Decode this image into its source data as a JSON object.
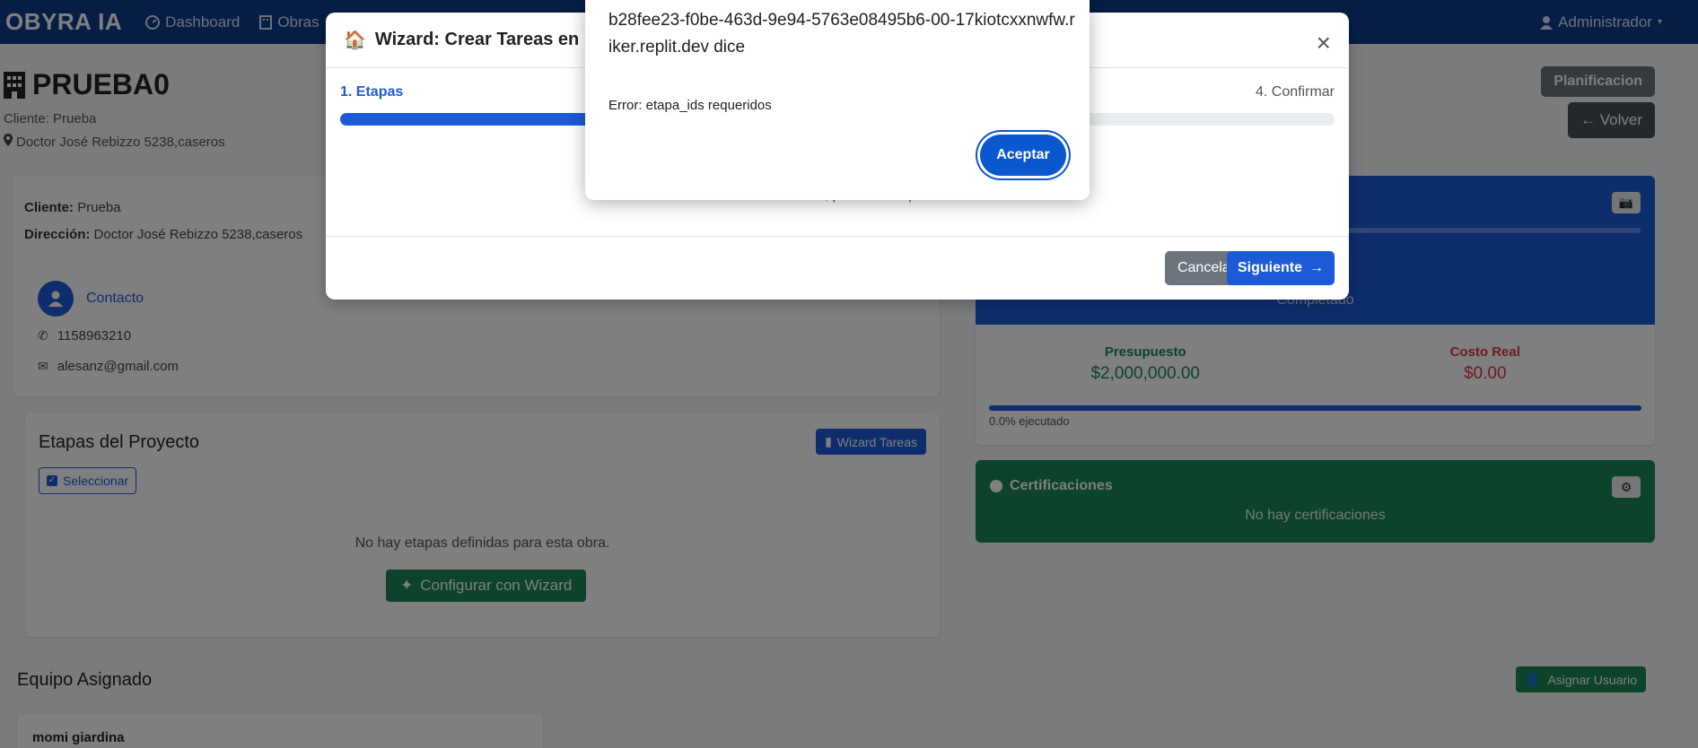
{
  "navbar": {
    "brand": "OBYRA IA",
    "links": [
      "Dashboard",
      "Obras"
    ],
    "user": "Administrador"
  },
  "page": {
    "title": "PRUEBA0",
    "client_line": "Cliente: Prueba",
    "address_line": "Doctor José Rebizzo 5238,caseros",
    "btn_planificacion": "Planificacion",
    "btn_volver": "Volver"
  },
  "info_card": {
    "cliente_label": "Cliente:",
    "cliente_value": "Prueba",
    "direccion_label": "Dirección:",
    "direccion_value": "Doctor José Rebizzo 5238,caseros",
    "contacto_label": "Contacto",
    "phone": "1158963210",
    "email": "alesanz@gmail.com"
  },
  "etapas_card": {
    "title": "Etapas del Proyecto",
    "wizard_btn": "Wizard Tareas",
    "select_btn": "Seleccionar",
    "empty_text": "No hay etapas definidas para esta obra.",
    "config_btn": "Configurar con Wizard"
  },
  "equipo": {
    "title": "Equipo Asignado",
    "assign_btn": "Asignar Usuario",
    "member": "momi giardina"
  },
  "summary_card": {
    "status": "Completado",
    "presupuesto_label": "Presupuesto",
    "presupuesto_value": "$2,000,000.00",
    "costo_label": "Costo Real",
    "costo_value": "$0.00",
    "executed_text": "0.0% ejecutado",
    "executed_percent": 0
  },
  "cert_card": {
    "title": "Certificaciones",
    "empty_text": "No hay certificaciones"
  },
  "wizard_modal": {
    "title": "Wizard: Crear Tareas en Lo",
    "step_first": "1. Etapas",
    "step_last": "4. Confirmar",
    "progress_percent": 25,
    "body_text": "Creando tareas, por favor espere...",
    "cancel_btn": "Cancelar",
    "next_btn": "Siguiente"
  },
  "alert_dialog": {
    "title": "b28fee23-f0be-463d-9e94-5763e08495b6-00-17kiotcxxnwfw.riker.replit.dev dice",
    "message": "Error: etapa_ids requeridos",
    "accept_btn": "Aceptar"
  },
  "colors": {
    "navbar": "#0d3a8c",
    "primary": "#1d5ad8",
    "success": "#198754",
    "danger": "#dc3545"
  }
}
